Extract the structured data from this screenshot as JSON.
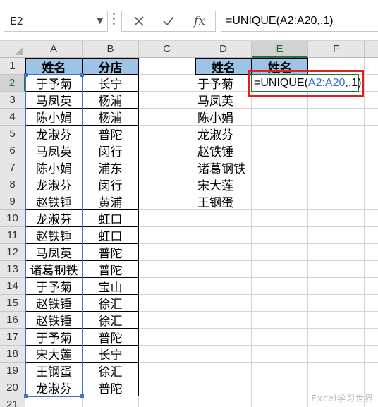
{
  "name_box": {
    "value": "E2"
  },
  "formula_bar": {
    "cancel_icon": "x-icon",
    "enter_icon": "check-icon",
    "fx_label": "fx",
    "formula": "=UNIQUE(A2:A20,,1)"
  },
  "columns": [
    "A",
    "B",
    "C",
    "D",
    "E",
    "F"
  ],
  "selected_column": "E",
  "rows": [
    "1",
    "2",
    "3",
    "4",
    "5",
    "6",
    "7",
    "8",
    "9",
    "10",
    "11",
    "12",
    "13",
    "14",
    "15",
    "16",
    "17",
    "18",
    "19",
    "20",
    "21"
  ],
  "selected_row": "2",
  "headers": {
    "a1": "姓名",
    "b1": "分店",
    "d1": "姓名",
    "e1": "姓名"
  },
  "col_a": [
    "于予菊",
    "马凤英",
    "陈小娟",
    "龙淑芬",
    "马凤英",
    "陈小娟",
    "龙淑芬",
    "赵铁锤",
    "龙淑芬",
    "赵铁锤",
    "马凤英",
    "诸葛钢铁",
    "于予菊",
    "赵铁锤",
    "赵铁锤",
    "于予菊",
    "宋大莲",
    "王钢蛋",
    "龙淑芬"
  ],
  "col_b": [
    "长宁",
    "杨浦",
    "杨浦",
    "普陀",
    "闵行",
    "浦东",
    "闵行",
    "黄浦",
    "虹口",
    "虹口",
    "普陀",
    "普陀",
    "宝山",
    "徐汇",
    "徐汇",
    "普陀",
    "长宁",
    "徐汇",
    "普陀"
  ],
  "col_d": [
    "于予菊",
    "马凤英",
    "陈小娟",
    "龙淑芬",
    "赵铁锤",
    "诸葛钢铁",
    "宋大莲",
    "王钢蛋"
  ],
  "edit_cell": {
    "prefix": "=UNIQUE(",
    "ref": "A2:A20",
    "suffix": ",,1)"
  },
  "colors": {
    "header_fill": "#9dc3e6",
    "selection_green": "#217346",
    "range_blue": "#4472c4",
    "highlight_red": "#e0201c"
  },
  "watermark": "Excel学习世界"
}
